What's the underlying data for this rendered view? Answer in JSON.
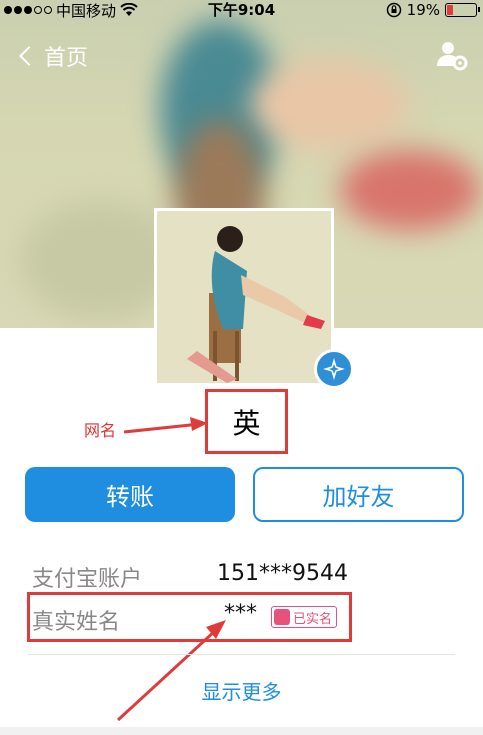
{
  "status_bar": {
    "carrier": "中国移动",
    "time": "下午9:04",
    "battery": "19%",
    "battery_level": 0.19,
    "wifi_icon": "wifi-icon",
    "lock_icon": "orientation-lock-icon"
  },
  "nav": {
    "back_label": "首页",
    "settings_icon": "user-settings-icon"
  },
  "profile": {
    "nickname": "英",
    "verified_icon": "verified-badge-icon"
  },
  "annotations": {
    "nickname_label": "网名"
  },
  "actions": {
    "transfer_label": "转账",
    "add_friend_label": "加好友"
  },
  "info": {
    "account_label": "支付宝账户",
    "account_value": "151***9544",
    "real_name_label": "真实姓名",
    "real_name_value": "***",
    "verified_tag": "已实名"
  },
  "footer": {
    "show_more": "显示更多"
  },
  "colors": {
    "accent": "#1f8ee0",
    "annotation_red": "#e03b3b",
    "tag_pink": "#e5527a"
  }
}
